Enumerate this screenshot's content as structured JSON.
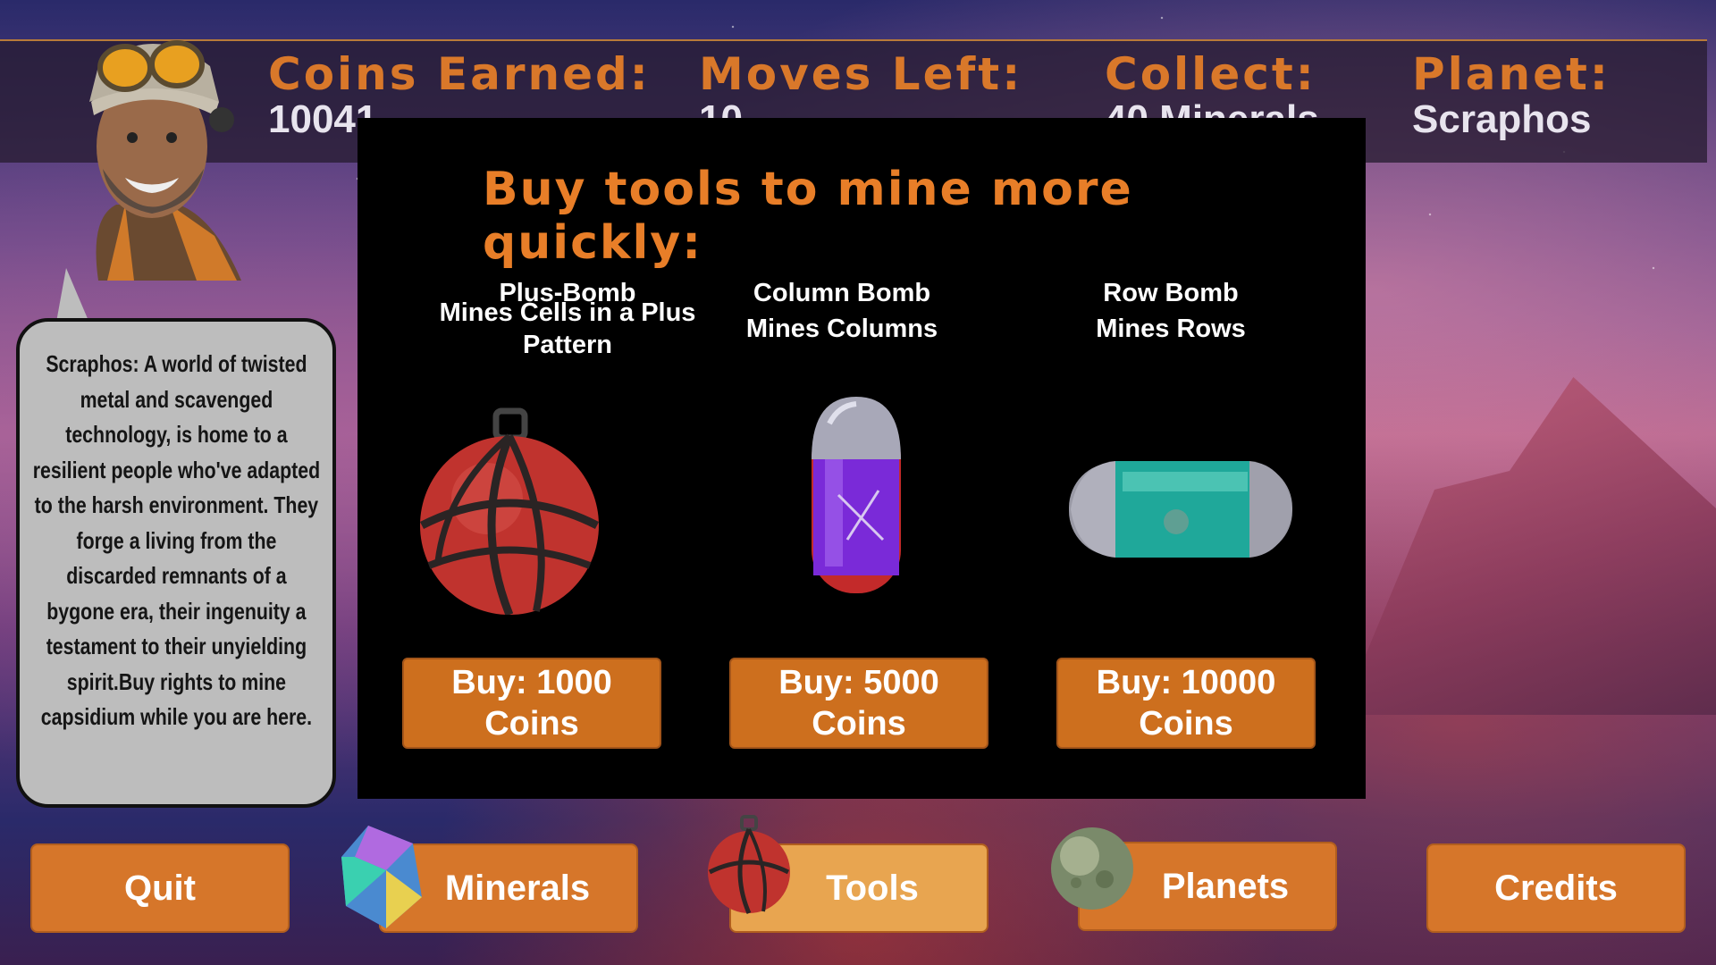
{
  "hud": {
    "coins_label": "Coins Earned:",
    "coins_value": "10041",
    "moves_label": "Moves Left:",
    "moves_value": "10",
    "collect_label": "Collect:",
    "collect_value": "40 Minerals",
    "planet_label": "Planet:",
    "planet_value": "Scraphos"
  },
  "bubble": {
    "text": "Scraphos: A world of twisted metal and scavenged technology, is home to a resilient people who've adapted to the harsh environment. They forge a living from the discarded remnants of a bygone era, their ingenuity a testament to their unyielding spirit.Buy rights to mine capsidium while you are here."
  },
  "shop": {
    "title": "Buy tools to mine more quickly:",
    "items": [
      {
        "name": "Plus-Bomb",
        "desc": "Mines Cells in a Plus Pattern",
        "buy_label": "Buy: 1000 Coins",
        "icon": "plus-bomb-icon"
      },
      {
        "name": "Column Bomb",
        "desc": "Mines Columns",
        "buy_label": "Buy: 5000 Coins",
        "icon": "column-bomb-icon"
      },
      {
        "name": "Row Bomb",
        "desc": "Mines Rows",
        "buy_label": "Buy: 10000 Coins",
        "icon": "row-bomb-icon"
      }
    ]
  },
  "nav": {
    "quit": "Quit",
    "minerals": "Minerals",
    "tools": "Tools",
    "planets": "Planets",
    "credits": "Credits",
    "active": "tools"
  },
  "colors": {
    "accent_orange": "#d6762a",
    "title_orange": "#e87e28",
    "panel_bg": "#000000",
    "bubble_bg": "#bdbdbd"
  }
}
